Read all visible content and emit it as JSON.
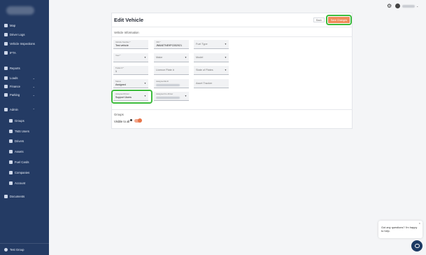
{
  "sidebar": {
    "items": [
      {
        "label": "Map",
        "icon": "map-icon"
      },
      {
        "label": "Driver Logs",
        "icon": "document-icon"
      },
      {
        "label": "Vehicle Inspections",
        "icon": "clipboard-icon"
      },
      {
        "label": "IFTA",
        "icon": "report-icon"
      },
      {
        "label": "Reports",
        "icon": "chart-icon"
      },
      {
        "label": "Loads",
        "icon": "box-icon"
      },
      {
        "label": "Finance",
        "icon": "dollar-icon"
      },
      {
        "label": "Parking",
        "icon": "parking-icon"
      },
      {
        "label": "Admin",
        "icon": "gear-icon"
      },
      {
        "label": "Groups",
        "icon": "group-icon"
      },
      {
        "label": "TMS Users",
        "icon": "users-icon"
      },
      {
        "label": "Drivers",
        "icon": "driver-icon"
      },
      {
        "label": "Assets",
        "icon": "truck-icon"
      },
      {
        "label": "Fuel Cards",
        "icon": "card-icon"
      },
      {
        "label": "Companies",
        "icon": "building-icon"
      },
      {
        "label": "Account",
        "icon": "account-icon"
      },
      {
        "label": "Documents",
        "icon": "folder-icon"
      }
    ],
    "footer": "Test Group"
  },
  "header": {
    "title": "Edit Vehicle",
    "back_label": "Back",
    "save_label": "Save Changes"
  },
  "vehicle_info": {
    "section_title": "Vehicle Information",
    "fields": {
      "vehicle_number": {
        "label": "Vehicle Number *",
        "value": "Test vehicle"
      },
      "vin": {
        "label": "VIN *",
        "value": "JN8AE7NE9PC052921"
      },
      "fuel_type": {
        "placeholder": "Fuel Type"
      },
      "year": {
        "label": "Year *"
      },
      "make": {
        "placeholder": "Make"
      },
      "model": {
        "placeholder": "Model"
      },
      "trailer_number": {
        "label": "Trailer # *",
        "value": "1"
      },
      "license_plate": {
        "placeholder": "Licence Plate #"
      },
      "state_of_plates": {
        "placeholder": "State of Plates"
      },
      "status": {
        "label": "Status",
        "value": "Assigned"
      },
      "assigned_eld": {
        "label": "Assigned ELD"
      },
      "asset_tracker": {
        "placeholder": "Asset Tracker"
      },
      "assigned_driver": {
        "label": "Assigned Driver",
        "value": "Support Users"
      },
      "assigned_codriver": {
        "label": "Assigned Co-Driver"
      }
    }
  },
  "groups": {
    "section_title": "Groups",
    "visible_to_all_label": "Visible to all",
    "visible_to_all": true
  },
  "chat": {
    "message": "Got any questions? I'm happy to help."
  },
  "colors": {
    "sidebar": "#243b64",
    "accent": "#f08c5a",
    "highlight": "#3dbb3d"
  }
}
